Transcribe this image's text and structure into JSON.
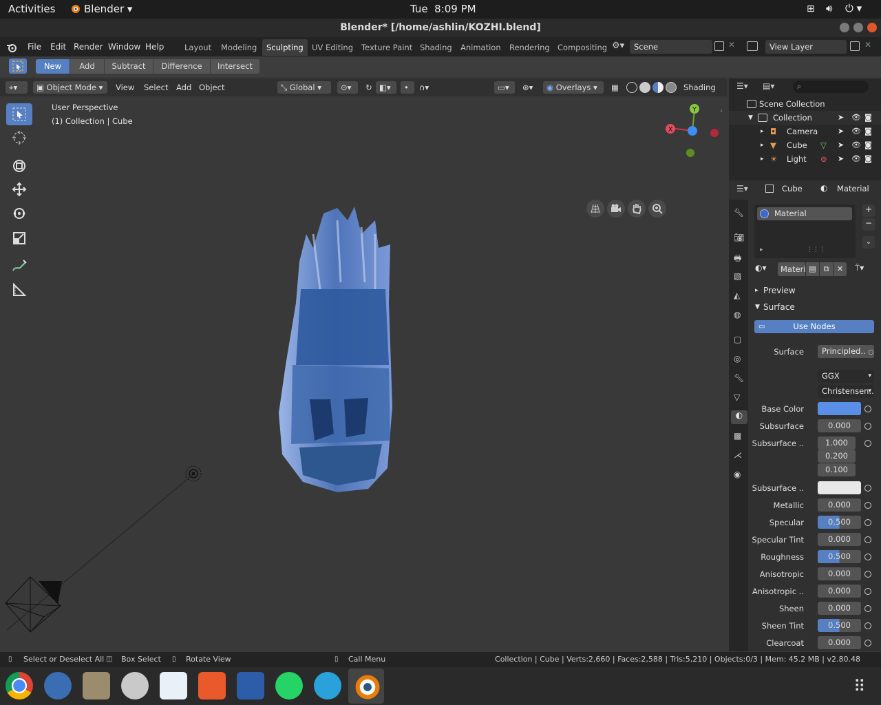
{
  "gnome": {
    "activities": "Activities",
    "app": "Blender",
    "clock": "Tue  8:09 PM"
  },
  "window": {
    "title": "Blender* [/home/ashlin/KOZHI.blend]"
  },
  "menus": [
    "File",
    "Edit",
    "Render",
    "Window",
    "Help"
  ],
  "workspaces": [
    "Layout",
    "Modeling",
    "Sculpting",
    "UV Editing",
    "Texture Paint",
    "Shading",
    "Animation",
    "Rendering",
    "Compositing"
  ],
  "active_workspace": "Sculpting",
  "scene": "Scene",
  "view_layer": "View Layer",
  "boolean_ops": [
    "New",
    "Add",
    "Subtract",
    "Difference",
    "Intersect"
  ],
  "viewport_header": {
    "mode": "Object Mode",
    "menus": [
      "View",
      "Select",
      "Add",
      "Object"
    ],
    "orientation": "Global",
    "overlays": "Overlays",
    "shading": "Shading"
  },
  "viewport": {
    "perspective": "User Perspective",
    "collection": "(1) Collection | Cube"
  },
  "gizmo": {
    "y": "Y",
    "x": "X"
  },
  "outliner": {
    "root": "Scene Collection",
    "collection": "Collection",
    "items": [
      "Camera",
      "Cube",
      "Light"
    ]
  },
  "props_header": {
    "object": "Cube",
    "material_tab": "Material"
  },
  "material_slot": "Material",
  "material_name": "Materi",
  "panels": {
    "preview": "Preview",
    "surface": "Surface"
  },
  "use_nodes": "Use Nodes",
  "surface_shader": {
    "label": "Surface",
    "value": "Principled.."
  },
  "distribution": "GGX",
  "subsurface_method": "Christensen..",
  "properties": [
    {
      "label": "Base Color",
      "value": ""
    },
    {
      "label": "Subsurface",
      "value": "0.000"
    },
    {
      "label": "Subsurface ..",
      "value": "1.000"
    },
    {
      "label": "",
      "value": "0.200"
    },
    {
      "label": "",
      "value": "0.100"
    },
    {
      "label": "Subsurface ..",
      "value": ""
    },
    {
      "label": "Metallic",
      "value": "0.000"
    },
    {
      "label": "Specular",
      "value": "0.500"
    },
    {
      "label": "Specular Tint",
      "value": "0.000"
    },
    {
      "label": "Roughness",
      "value": "0.500"
    },
    {
      "label": "Anisotropic",
      "value": "0.000"
    },
    {
      "label": "Anisotropic ..",
      "value": "0.000"
    },
    {
      "label": "Sheen",
      "value": "0.000"
    },
    {
      "label": "Sheen Tint",
      "value": "0.500"
    },
    {
      "label": "Clearcoat",
      "value": "0.000"
    }
  ],
  "colors": {
    "base_color": "#5b8ee6",
    "subsurface_color": "#e8e8e8",
    "accent": "#5680c2"
  },
  "status": {
    "select": "Select or Deselect All",
    "box": "Box Select",
    "rotate": "Rotate View",
    "menu": "Call Menu",
    "stats": "Collection | Cube | Verts:2,660 | Faces:2,588 | Tris:5,210 | Objects:0/3 | Mem: 45.2 MB | v2.80.48"
  }
}
